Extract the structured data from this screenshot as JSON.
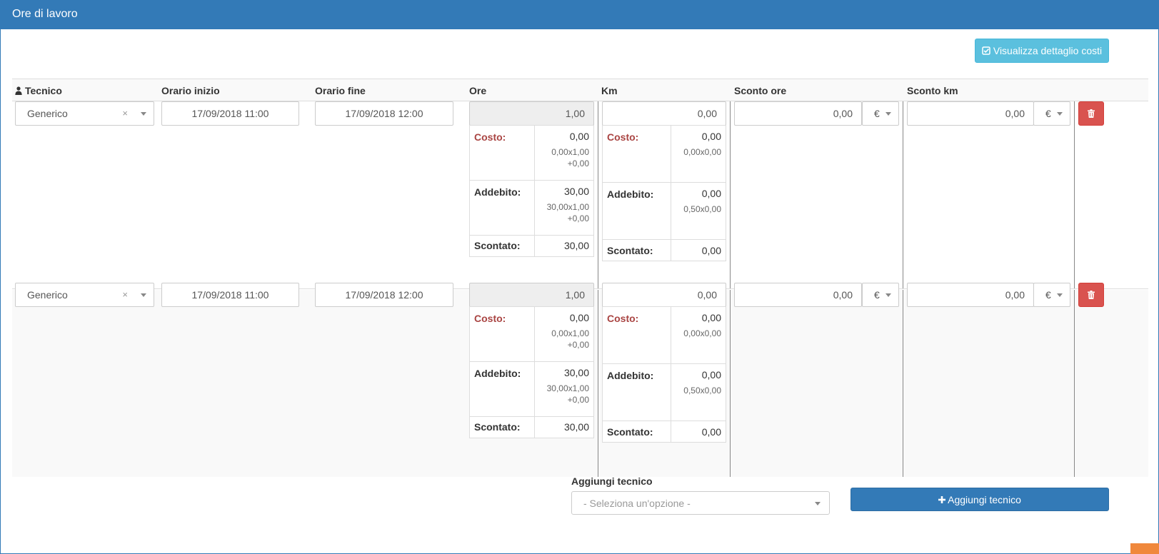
{
  "panel": {
    "title": "Ore di lavoro"
  },
  "toolbar": {
    "view_costs_label": "Visualizza dettaglio costi"
  },
  "table": {
    "headers": {
      "tecnico": "Tecnico",
      "inizio": "Orario inizio",
      "fine": "Orario fine",
      "ore": "Ore",
      "km": "Km",
      "sconto_ore": "Sconto ore",
      "sconto_km": "Sconto km"
    },
    "labels": {
      "costo": "Costo:",
      "addebito": "Addebito:",
      "scontato": "Scontato:"
    },
    "rows": [
      {
        "tecnico": "Generico",
        "clear": "×",
        "inizio": "17/09/2018 11:00",
        "fine": "17/09/2018 12:00",
        "ore": "1,00",
        "km": "0,00",
        "sconto_ore": "0,00",
        "sconto_ore_unit": "€",
        "sconto_km": "0,00",
        "sconto_km_unit": "€",
        "ore_costs": {
          "costo": "0,00",
          "costo_formula": "0,00x1,00",
          "costo_extra": "+0,00",
          "addebito": "30,00",
          "addebito_formula": "30,00x1,00",
          "addebito_extra": "+0,00",
          "scontato": "30,00"
        },
        "km_costs": {
          "costo": "0,00",
          "costo_formula": "0,00x0,00",
          "addebito": "0,00",
          "addebito_formula": "0,50x0,00",
          "scontato": "0,00"
        }
      },
      {
        "tecnico": "Generico",
        "clear": "×",
        "inizio": "17/09/2018 11:00",
        "fine": "17/09/2018 12:00",
        "ore": "1,00",
        "km": "0,00",
        "sconto_ore": "0,00",
        "sconto_ore_unit": "€",
        "sconto_km": "0,00",
        "sconto_km_unit": "€",
        "ore_costs": {
          "costo": "0,00",
          "costo_formula": "0,00x1,00",
          "costo_extra": "+0,00",
          "addebito": "30,00",
          "addebito_formula": "30,00x1,00",
          "addebito_extra": "+0,00",
          "scontato": "30,00"
        },
        "km_costs": {
          "costo": "0,00",
          "costo_formula": "0,00x0,00",
          "addebito": "0,00",
          "addebito_formula": "0,50x0,00",
          "scontato": "0,00"
        }
      }
    ]
  },
  "add_tecnico": {
    "label": "Aggiungi tecnico",
    "select_placeholder": "- Seleziona un'opzione -",
    "button_label": "Aggiungi tecnico"
  },
  "colors": {
    "primary": "#337ab7",
    "info": "#5bc0de",
    "danger": "#d9534f",
    "label_red": "#a94442"
  },
  "icons": [
    "user-icon",
    "check-square-icon",
    "trash-icon",
    "plus-icon",
    "chevron-down-icon",
    "clear-icon"
  ]
}
